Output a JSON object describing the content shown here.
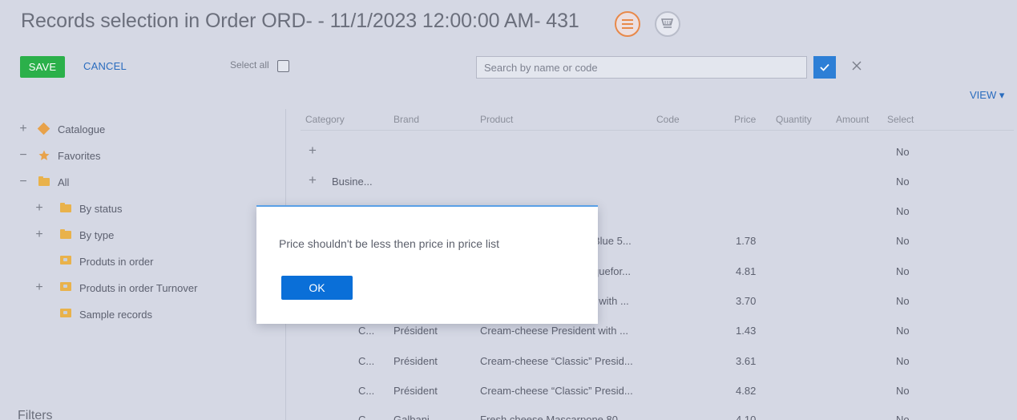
{
  "header": {
    "title": "Records selection in Order ORD- - 11/1/2023 12:00:00 AM- 431",
    "actions": [
      {
        "icon": "list-icon",
        "active": true
      },
      {
        "icon": "cart-icon",
        "active": false
      }
    ]
  },
  "toolbar": {
    "save_label": "SAVE",
    "cancel_label": "CANCEL",
    "select_all_label": "Select all",
    "search_placeholder": "Search by name or code",
    "view_label": "VIEW ▾"
  },
  "tree": {
    "items": [
      {
        "toggle": "+",
        "icon": "diamond-icon",
        "label": "Catalogue"
      },
      {
        "toggle": "−",
        "icon": "star-icon",
        "label": "Favorites"
      },
      {
        "toggle": "−",
        "icon": "folder-icon",
        "label": "All"
      },
      {
        "toggle": "+",
        "icon": "folder-icon",
        "label": "By status"
      },
      {
        "toggle": "+",
        "icon": "folder-icon",
        "label": "By type"
      },
      {
        "toggle": "",
        "icon": "filter-folder-icon",
        "label": "Produts in order"
      },
      {
        "toggle": "+",
        "icon": "filter-folder-icon",
        "label": "Produts in order Turnover"
      },
      {
        "toggle": "",
        "icon": "filter-folder-icon",
        "label": "Sample records"
      }
    ],
    "filters_label": "Filters"
  },
  "grid": {
    "columns": [
      "Category",
      "Brand",
      "Product",
      "Code",
      "Price",
      "Quantity",
      "Amount",
      "Select"
    ],
    "rows": [
      {
        "group": "+",
        "category": "",
        "brand": "",
        "product": "",
        "price": "",
        "select": "No"
      },
      {
        "group": "+",
        "category": "Busine...",
        "brand": "",
        "product": "",
        "price": "",
        "select": "No"
      },
      {
        "group": "",
        "category": "",
        "brand": "",
        "product": "",
        "price": "",
        "select": "No"
      },
      {
        "group": "",
        "category": "",
        "brand": "",
        "product": "Blue 5...",
        "price": "1.78",
        "select": "No"
      },
      {
        "group": "",
        "category": "",
        "brand": "",
        "product": "quefor...",
        "price": "4.81",
        "select": "No"
      },
      {
        "group": "",
        "category": "",
        "brand": "",
        "product": "t with ...",
        "price": "3.70",
        "select": "No"
      },
      {
        "group": "",
        "category": "C...",
        "brand": "Président",
        "product": "Cream-cheese President with ...",
        "price": "1.43",
        "select": "No"
      },
      {
        "group": "",
        "category": "C...",
        "brand": "Président",
        "product": "Cream-cheese “Classic” Presid...",
        "price": "3.61",
        "select": "No"
      },
      {
        "group": "",
        "category": "C...",
        "brand": "Président",
        "product": "Cream-cheese “Classic” Presid...",
        "price": "4.82",
        "select": "No"
      },
      {
        "group": "",
        "category": "C...",
        "brand": "Galbani",
        "product": "Fresh cheese Mascarpone 80...",
        "price": "4.10",
        "select": "No"
      }
    ]
  },
  "dialog": {
    "message": "Price shouldn't be less then price in price list",
    "ok_label": "OK"
  },
  "colors": {
    "background": "#d5d8e4",
    "save": "#2bb04a",
    "link": "#2a6cbe",
    "primary": "#0a6fd8",
    "folder": "#e9b24b"
  }
}
